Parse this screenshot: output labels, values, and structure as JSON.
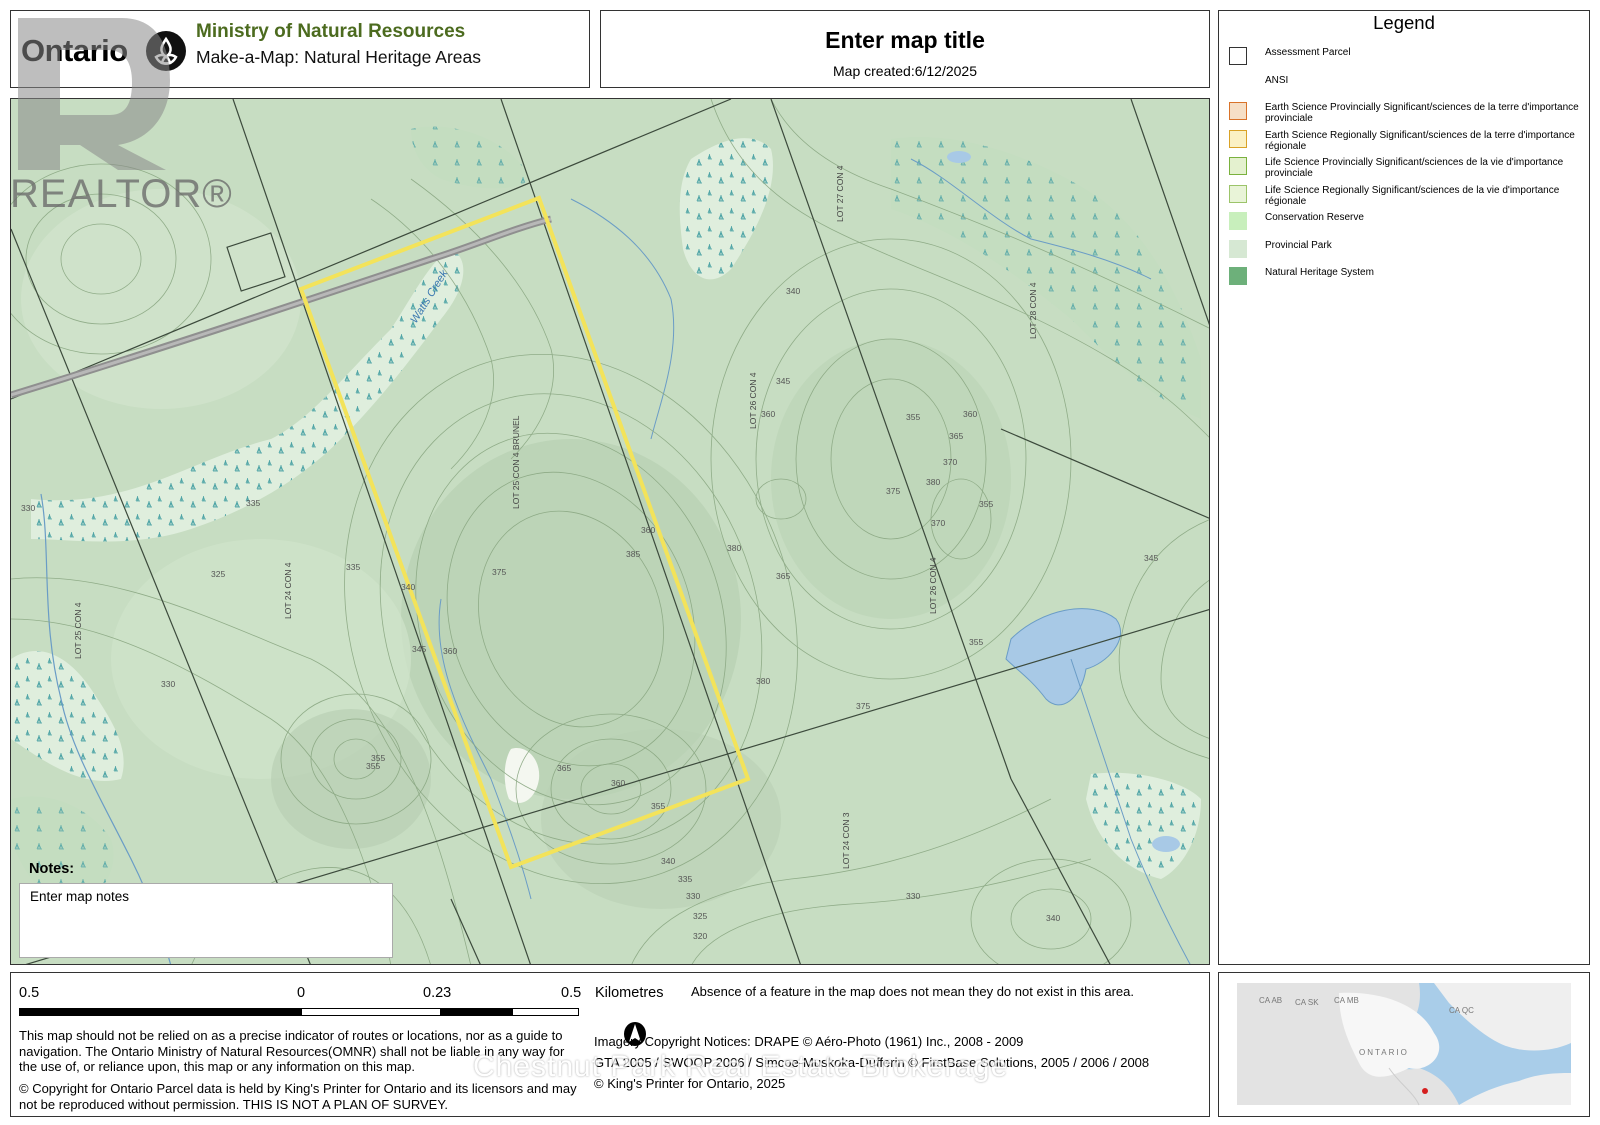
{
  "header": {
    "logo_text": "Ontario",
    "ministry": "Ministry of Natural Resources",
    "subtitle": "Make-a-Map: Natural Heritage Areas"
  },
  "title_box": {
    "title": "Enter map title",
    "created": "Map created:6/12/2025"
  },
  "legend": {
    "heading": "Legend",
    "items": [
      {
        "label": "Assessment Parcel",
        "swatch": "#ffffff",
        "border": "#333333"
      },
      {
        "label": "ANSI",
        "swatch": "none",
        "border": "none"
      },
      {
        "label": "Earth Science Provincially Significant/sciences de la terre d'importance provinciale",
        "swatch": "#f6dfc6",
        "border": "#d9732a"
      },
      {
        "label": "Earth Science Regionally Significant/sciences de la terre d'importance régionale",
        "swatch": "#fbf1c4",
        "border": "#d9a227"
      },
      {
        "label": "Life Science Provincially Significant/sciences de la vie d'importance provinciale",
        "swatch": "#e4f1cf",
        "border": "#7ab13e"
      },
      {
        "label": "Life Science Regionally Significant/sciences de la vie d'importance régionale",
        "swatch": "#e9f4d8",
        "border": "#9cc46a"
      },
      {
        "label": "Conservation Reserve",
        "swatch": "#c8efbc",
        "border": "none"
      },
      {
        "label": "Provincial Park",
        "swatch": "#d6e8d3",
        "border": "none"
      },
      {
        "label": "Natural Heritage System",
        "swatch": "#6db07a",
        "border": "none"
      }
    ]
  },
  "map": {
    "creek_label": "Watts Creek",
    "lot_labels": [
      {
        "text": "LOT 27 CON 4"
      },
      {
        "text": "LOT 28 CON 4"
      },
      {
        "text": "LOT 26 CON 4"
      },
      {
        "text": "LOT 25 CON 4 BRUNEL"
      },
      {
        "text": "LOT 24 CON 4"
      },
      {
        "text": "LOT 25 CON 4"
      },
      {
        "text": "LOT 26 CON 4"
      },
      {
        "text": "LOT 24 CON 3"
      }
    ],
    "contour_labels": [
      "340",
      "345",
      "360",
      "355",
      "360",
      "365",
      "370",
      "380",
      "375",
      "355",
      "385",
      "380",
      "375",
      "370",
      "335",
      "330",
      "325",
      "330",
      "335",
      "340",
      "345",
      "360",
      "355",
      "365",
      "360",
      "355",
      "340",
      "335",
      "330",
      "325",
      "320",
      "360",
      "375",
      "355",
      "365",
      "380",
      "345",
      "355",
      "340",
      "330"
    ]
  },
  "notes": {
    "label": "Notes:",
    "text": "Enter map notes"
  },
  "scale": {
    "labels": [
      "0.5",
      "0",
      "0.23",
      "0.5"
    ],
    "unit": "Kilometres"
  },
  "footer": {
    "absence_note": "Absence of a feature in the map does not mean they do not exist in this area.",
    "disclaimer_1": "This map should not be relied on as a precise indicator of routes or locations, nor as a guide to navigation. The Ontario Ministry of Natural Resources(OMNR) shall not be liable in any way for the use of, or reliance upon, this map or any information on this map.",
    "disclaimer_2": "© Copyright for Ontario Parcel data is held by King's Printer for Ontario and its licensors and may not be reproduced without permission. THIS IS NOT A PLAN OF SURVEY.",
    "imagery_1": "Imagery Copyright Notices: DRAPE © Aéro-Photo (1961) Inc., 2008 - 2009",
    "imagery_2": "GTA 2005 / SWOOP 2006 / Simcoe-Muskoka-Dufferin © FirstBase Solutions, 2005 / 2006 / 2008",
    "imagery_3": "© King's Printer for Ontario,  2025"
  },
  "inset": {
    "labels": [
      "CA AB",
      "CA SK",
      "CA MB",
      "CA QC",
      "ONTARIO"
    ]
  },
  "watermark": {
    "realtor": "REALTOR®",
    "brokerage": "Chestnut Park Real Estate Brokerage"
  }
}
